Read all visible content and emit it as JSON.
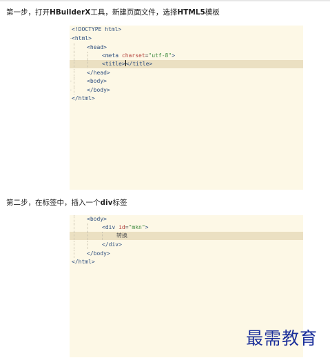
{
  "step1": {
    "prefix": "第一步，打开",
    "bold1": "HBuilderX",
    "mid": "工具，新建页面文件，选择",
    "bold2": "HTML5",
    "suffix": "模板"
  },
  "step2": {
    "prefix": "第二步，在标签中，插入一个",
    "bold": "div",
    "suffix": "标签"
  },
  "code1": {
    "doctype": "<!DOCTYPE html>",
    "html_open": "<html>",
    "head_open": "<head>",
    "meta_tag": "<meta",
    "meta_attr": "charset",
    "meta_eq": "=",
    "meta_val": "\"utf-8\"",
    "meta_close": ">",
    "title_open": "<title>",
    "title_close": "</title>",
    "head_close": "</head>",
    "body_open": "<body>",
    "body_close": "</body>",
    "html_close": "</html>"
  },
  "code2": {
    "body_open": "<body>",
    "div_tag": "<div",
    "div_attr": "id",
    "div_eq": "=",
    "div_val": "\"mkn\"",
    "div_close_bracket": ">",
    "text": "转换",
    "div_close": "</div>",
    "body_close": "</body>",
    "html_close": "</html>"
  },
  "watermark": "最需教育"
}
